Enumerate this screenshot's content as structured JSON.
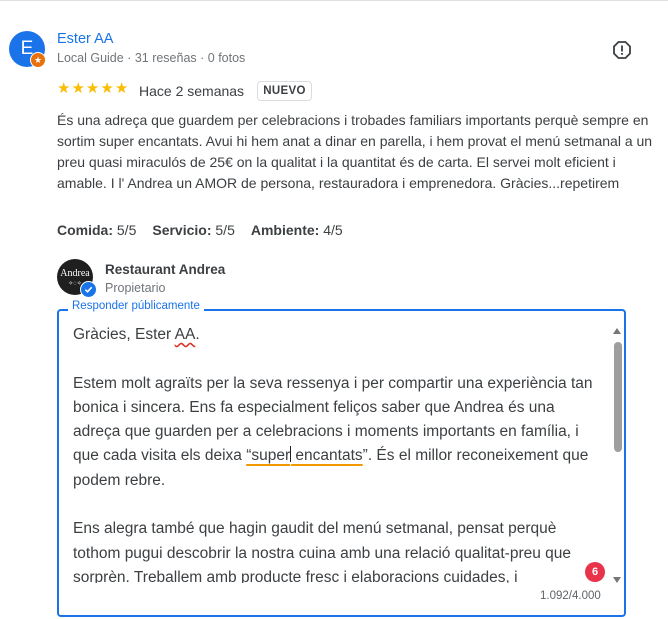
{
  "review": {
    "reviewer_initial": "E",
    "reviewer_name": "Ester AA",
    "reviewer_meta": "Local Guide · 31 reseñas · 0 fotos",
    "stars": 5,
    "date": "Hace 2 semanas",
    "badge": "NUEVO",
    "text": "És una adreça que guardem per celebracions i trobades familiars importants perquè sempre en sortim super encantats. Avui hi hem anat a dinar en parella, i hem provat el menú setmanal a un preu quasi miraculós de 25€ on la qualitat i la quantitat és de carta. El servei molt eficient i amable. I l' Andrea un AMOR de persona, restauradora i emprenedora. Gràcies...repetirem",
    "subratings": [
      {
        "label": "Comida:",
        "value": "5/5"
      },
      {
        "label": "Servicio:",
        "value": "5/5"
      },
      {
        "label": "Ambiente:",
        "value": "4/5"
      }
    ],
    "icons": {
      "flag": "report-icon",
      "star": "star-icon",
      "guide": "local-guide-badge-icon"
    },
    "colors": {
      "accent": "#1a73e8",
      "star": "#fbbc04",
      "error": "#e8334a"
    }
  },
  "owner": {
    "avatar_text": "Andrea",
    "name": "Restaurant Andrea",
    "role": "Propietario"
  },
  "reply": {
    "label": "Responder públicamente",
    "line1_a": "Gràcies, Ester ",
    "line1_b": "AA",
    "line1_c": ".",
    "para2_a": "Estem molt agraïts per la seva ressenya i per compartir una experiència tan bonica i sincera. Ens fa especialment feliços saber que Andrea és una adreça que guarden per a celebracions i moments importants en família, i que cada visita els deixa ",
    "para2_b": "“super",
    "para2_c": " encantats",
    "para2_d": "”. És el millor reconeixement que podem rebre.",
    "para3": "Ens alegra també que hagin gaudit del menú setmanal, pensat perquè tothom pugui descobrir la nostra cuina amb una relació qualitat-preu que sorprèn. Treballem amb producte fresc i elaboracions cuidades, i",
    "error_count": "6",
    "char_count": "1.092/4.000"
  }
}
